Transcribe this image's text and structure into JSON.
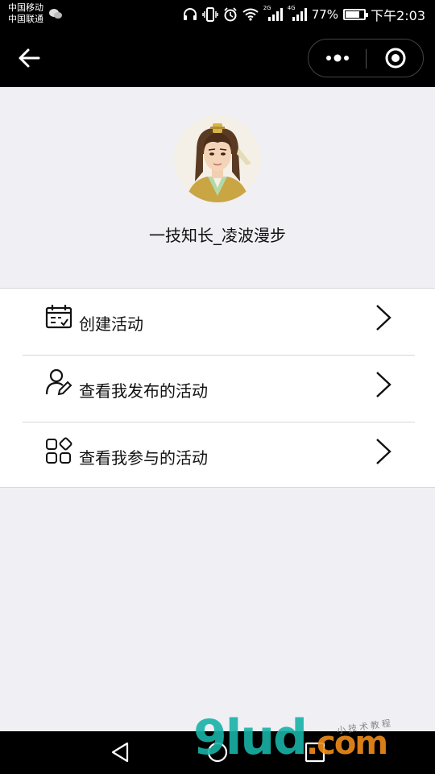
{
  "status_bar": {
    "carrier_1": "中国移动",
    "carrier_2": "中国联通",
    "net_2g": "2G",
    "net_4g": "4G",
    "battery": "77%",
    "time": "下午2:03"
  },
  "profile": {
    "username": "一技知长_凌波漫步",
    "avatar_icon": "avatar-portrait"
  },
  "menu": {
    "items": [
      {
        "label": "创建活动",
        "icon": "calendar-icon"
      },
      {
        "label": "查看我发布的活动",
        "icon": "user-edit-icon"
      },
      {
        "label": "查看我参与的活动",
        "icon": "apps-grid-icon"
      }
    ]
  },
  "watermark": {
    "brand": "9lud",
    "suffix": ".com",
    "small": "小技术教程"
  },
  "colors": {
    "background": "#efeff4",
    "bar": "#000000",
    "watermark_teal": "#19b3a8",
    "watermark_orange": "#f08c1a"
  }
}
